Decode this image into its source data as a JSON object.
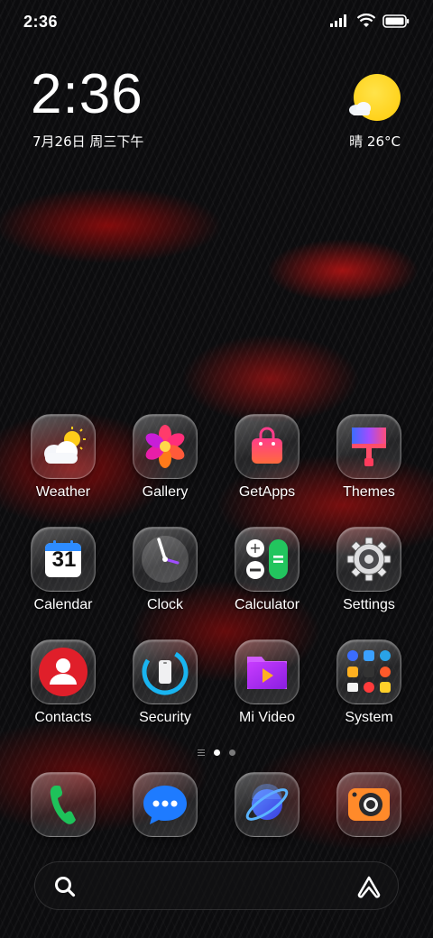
{
  "status_bar": {
    "time": "2:36"
  },
  "clock_widget": {
    "time": "2:36",
    "date": "7月26日 周三下午"
  },
  "weather_widget": {
    "text": "晴 26°C",
    "icon": "sun-cloud-icon"
  },
  "apps": [
    {
      "label": "Weather",
      "icon": "weather-icon"
    },
    {
      "label": "Gallery",
      "icon": "gallery-flower-icon"
    },
    {
      "label": "GetApps",
      "icon": "shopping-bag-icon"
    },
    {
      "label": "Themes",
      "icon": "paint-brush-icon"
    },
    {
      "label": "Calendar",
      "icon": "calendar-icon",
      "day": "31"
    },
    {
      "label": "Clock",
      "icon": "clock-icon"
    },
    {
      "label": "Calculator",
      "icon": "calculator-icon"
    },
    {
      "label": "Settings",
      "icon": "gear-icon"
    },
    {
      "label": "Contacts",
      "icon": "contacts-icon"
    },
    {
      "label": "Security",
      "icon": "security-shield-icon"
    },
    {
      "label": "Mi Video",
      "icon": "video-icon"
    },
    {
      "label": "System",
      "icon": "folder-icon"
    }
  ],
  "dock": [
    {
      "icon": "phone-icon"
    },
    {
      "icon": "messages-icon"
    },
    {
      "icon": "browser-planet-icon"
    },
    {
      "icon": "camera-icon"
    }
  ],
  "page_indicator": {
    "pages": 2,
    "active": 1
  },
  "colors": {
    "sun": "#ffcb08",
    "accent_red": "#e02020",
    "security_blue": "#19b4f0",
    "calc_green": "#22c55e"
  }
}
